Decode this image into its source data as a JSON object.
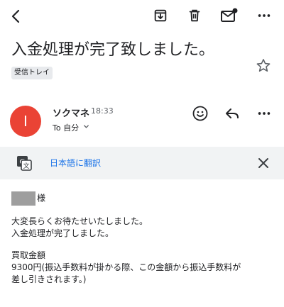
{
  "email": {
    "subject": "入金処理が完了致しました。",
    "label": "受信トレイ",
    "sender": {
      "initial": "I",
      "name": "ソクマネ",
      "time": "18:33",
      "to": "To 自分"
    },
    "translate": {
      "label": "日本語に翻訳"
    },
    "body": {
      "salutation_suffix": "様",
      "line1": "大変長らくお待たせいたしました。",
      "line2": "入金処理が完了しました。",
      "line3": "買取金額",
      "line4": "9300円(振込手数料が掛かる際、この金額から振込手数料が",
      "line5": "差し引きされます。)"
    }
  },
  "colors": {
    "avatar": "#ea4335",
    "link": "#1a73e8",
    "chip": "#e8eaed",
    "translate_bar": "#f1f3f4"
  },
  "icons": {
    "back": "arrow-back-icon",
    "archive": "archive-icon",
    "trash": "trash-icon",
    "mail": "mark-unread-icon",
    "more": "more-vert-icon",
    "star": "star-outline-icon",
    "emoji": "emoji-icon",
    "reply": "reply-icon",
    "translate": "translate-icon",
    "close": "close-icon"
  }
}
